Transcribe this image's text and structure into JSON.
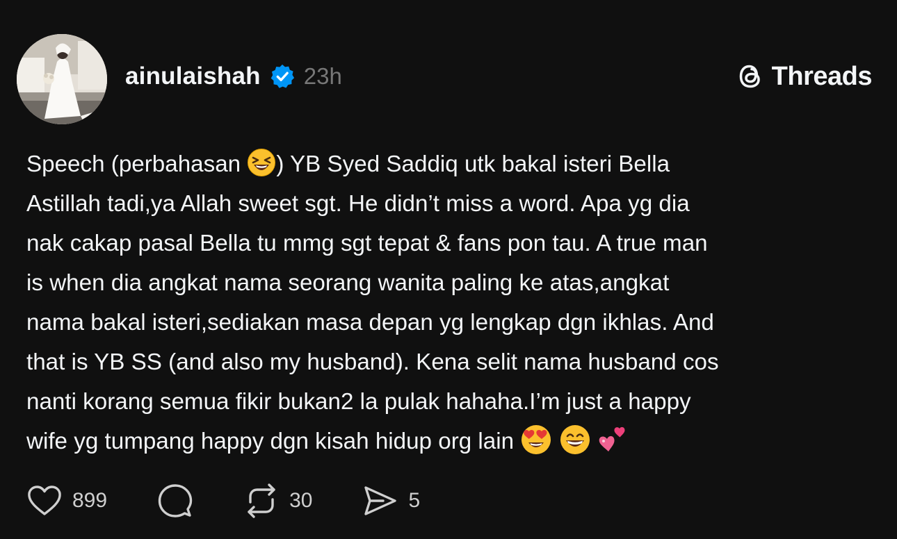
{
  "post": {
    "username": "ainulaishah",
    "timestamp": "23h",
    "brand": "Threads",
    "icons": {
      "verified": "verified-badge-icon",
      "brand": "threads-logo-icon",
      "like": "heart-icon",
      "reply": "comment-icon",
      "repost": "repost-icon",
      "share": "send-icon"
    },
    "lines": {
      "l1a": "Speech (perbahasan ",
      "l1b": ") YB Syed Saddiq utk bakal isteri Bella",
      "l2": "Astillah tadi,ya Allah sweet sgt. He didn’t miss a word. Apa yg dia",
      "l3": "nak cakap pasal Bella tu mmg sgt tepat & fans pon tau. A true man",
      "l4": "is when dia angkat nama seorang wanita paling ke atas,angkat",
      "l5": "nama bakal isteri,sediakan masa depan yg lengkap dgn ikhlas. And",
      "l6": "that is YB SS (and also my husband). Kena selit nama husband cos",
      "l7": "nanti korang semua fikir bukan2 la pulak hahaha.I’m just a happy",
      "l8": "wife yg tumpang happy dgn kisah hidup org lain "
    },
    "emojis": [
      "laughing-squint-emoji",
      "heart-eyes-emoji",
      "grinning-emoji",
      "two-hearts-emoji"
    ],
    "stats": {
      "likes": "899",
      "reposts": "30",
      "shares": "5"
    }
  },
  "colors": {
    "background": "#101010",
    "text": "#f3f5f7",
    "muted": "#777777",
    "verified": "#0095f6"
  }
}
